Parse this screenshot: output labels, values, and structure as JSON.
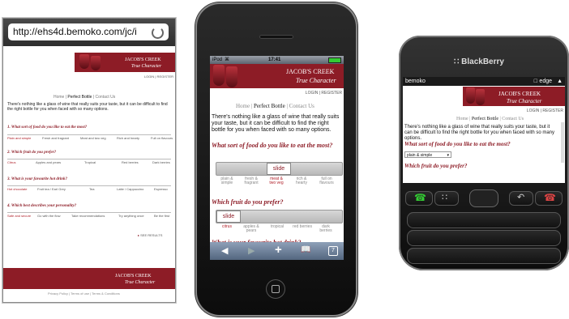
{
  "android": {
    "url": "http://ehs4d.bemoko.com/jc/i",
    "logo_line1": "JACOB'S CREEK",
    "logo_line2": "True Character",
    "header_links": "LOGIN | REGISTER",
    "nav": {
      "home": "Home",
      "sep1": " | ",
      "perfect": "Perfect Bottle",
      "sep2": " | ",
      "contact": "Contact Us"
    },
    "intro": "There's nothing like a glass of wine that really suits your taste, but it can be difficult to find the right bottle for you when faced with so many options.",
    "questions": [
      {
        "q": "1. What sort of food do you like to eat the most?",
        "opts": [
          "Plain and simple",
          "Fresh and fragrant",
          "Meat and two veg",
          "Rich and hearty",
          "Full on flavours"
        ]
      },
      {
        "q": "2. Which fruit do you prefer?",
        "opts": [
          "Citrus",
          "Apples and pears",
          "Tropical",
          "Red berries",
          "Dark berries"
        ]
      },
      {
        "q": "3. What is your favourite hot drink?",
        "opts": [
          "Hot chocolate",
          "Fruit tea / Earl Grey",
          "Tea",
          "Latte / Cappuccino",
          "Espresso"
        ]
      },
      {
        "q": "4. Which best describes your personality?",
        "opts": [
          "Safe and secure",
          "Go with the flow",
          "Take recommendations",
          "Try anything once",
          "Be the first"
        ]
      }
    ],
    "see_results": "SEE RESULTS",
    "footer_logo1": "JACOB'S CREEK",
    "footer_logo2": "True Character",
    "footer_links": "Privacy Policy | Terms of use | Terms & Conditions"
  },
  "iphone": {
    "carrier": "iPod",
    "time": "17:41",
    "logo_line1": "JACOB'S CREEK",
    "logo_line2": "True Character",
    "header_links": "LOGIN | REGISTER",
    "nav": {
      "home": "Home",
      "sep1": " | ",
      "perfect": "Perfect Bottle",
      "sep2": " | ",
      "contact": "Contact Us"
    },
    "intro": "There's nothing like a glass of wine that really suits your taste, but it can be difficult to find the right bottle for you when faced with so many options.",
    "q1": "What sort of food do you like to eat the most?",
    "q1_opts": [
      "plain & simple",
      "fresh & fragrant",
      "meat & two veg",
      "rich & hearty",
      "full on flavours"
    ],
    "q1_selected": 2,
    "q2": "Which fruit do you prefer?",
    "q2_opts": [
      "citrus",
      "apples & pears",
      "tropical",
      "red berries",
      "dark berries"
    ],
    "q2_selected": 0,
    "q3_partial": "What is your favourite hot drink?",
    "slide_label": "slide",
    "tabs_count": "7"
  },
  "blackberry": {
    "brand": "BlackBerry",
    "carrier": "bemoko",
    "network": "edge",
    "logo_line1": "JACOB'S CREEK",
    "logo_line2": "True Character",
    "header_links": "LOGIN | REGISTER",
    "nav": {
      "home": "Home",
      "sep1": " | ",
      "perfect": "Perfect Bottle",
      "sep2": " | ",
      "contact": "Contact Us"
    },
    "intro": "There's nothing like a glass of wine that really suits your taste, but it can be difficult to find the right bottle for you when faced with so many options.",
    "q1": "What sort of food do you like to eat the most?",
    "q1_select": "plain & simple",
    "q2": "Which fruit do you prefer?"
  },
  "colors": {
    "brand_red": "#8d1c26",
    "link_red": "#b0202a"
  }
}
